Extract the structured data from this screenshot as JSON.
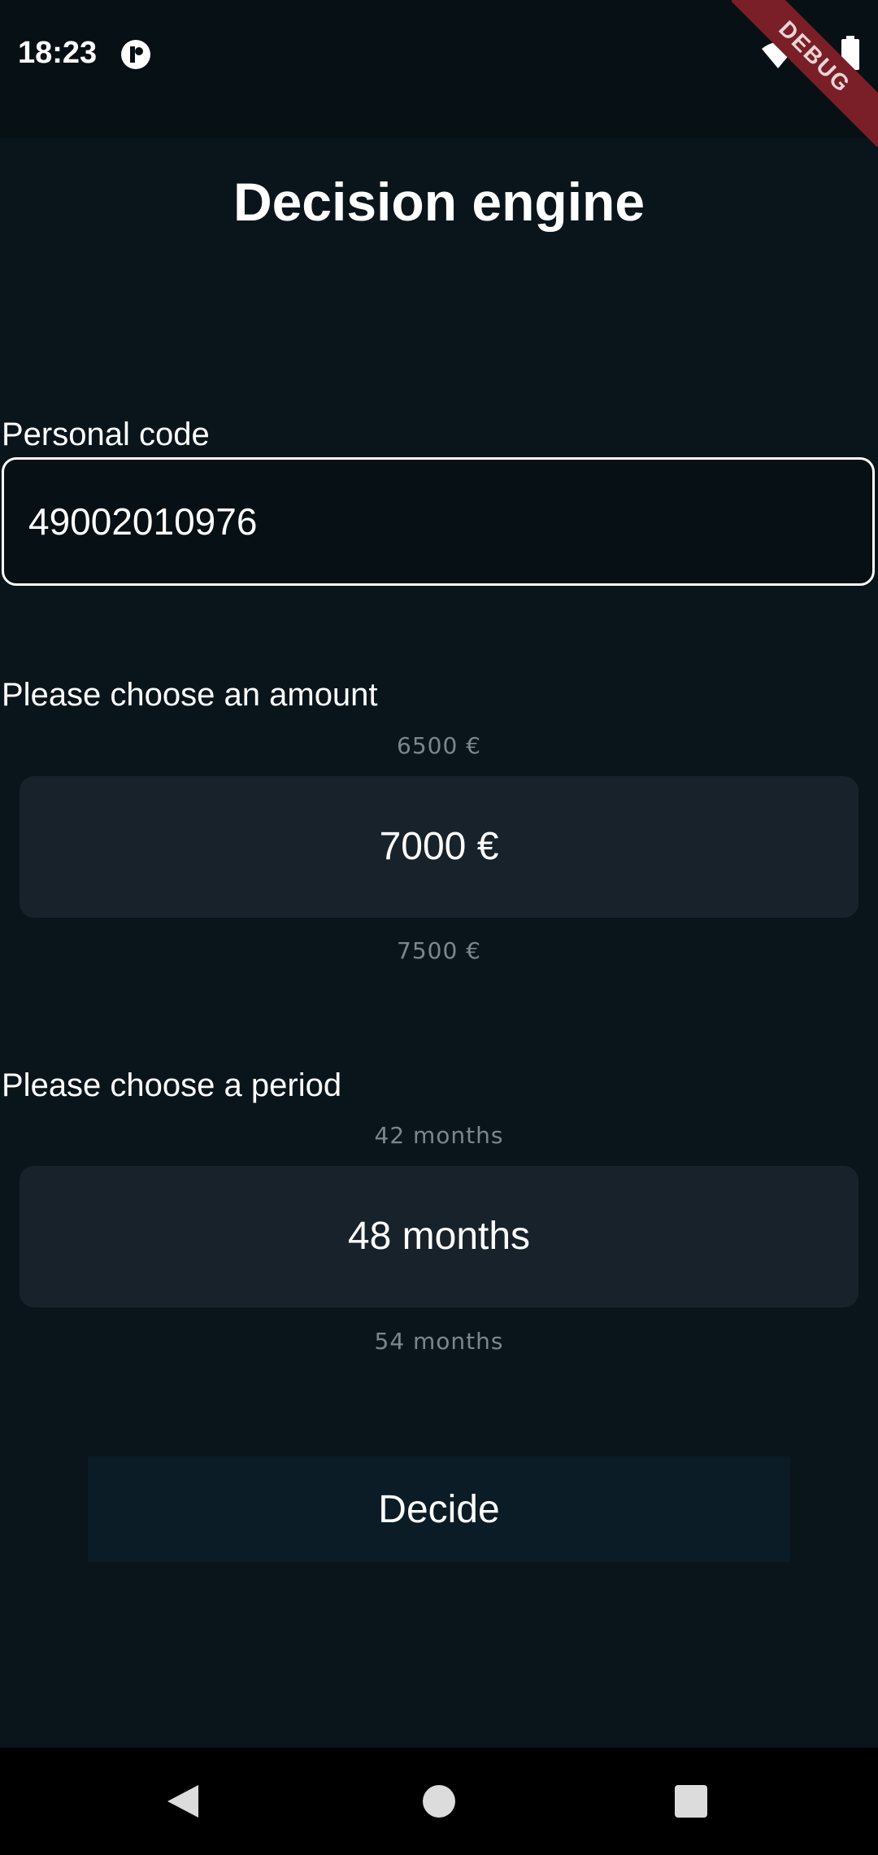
{
  "status_bar": {
    "time": "18:23",
    "debug_label": "DEBUG"
  },
  "title": "Decision engine",
  "personal_code": {
    "label": "Personal code",
    "value": "49002010976"
  },
  "amount_picker": {
    "label": "Please choose an amount",
    "prev": "6500 €",
    "selected": "7000 €",
    "next": "7500 €"
  },
  "period_picker": {
    "label": "Please choose a period",
    "prev": "42 months",
    "selected": "48 months",
    "next": "54 months"
  },
  "decide_button": {
    "label": "Decide"
  },
  "colors": {
    "background": "#0a151b",
    "picker_selected_bg": "#18222a",
    "button_bg": "#0c1c26",
    "debug_ribbon": "#7a1f27"
  },
  "icons": [
    "app-notification-icon",
    "wifi-icon",
    "signal-icon",
    "battery-icon",
    "back-icon",
    "home-icon",
    "recents-icon"
  ]
}
